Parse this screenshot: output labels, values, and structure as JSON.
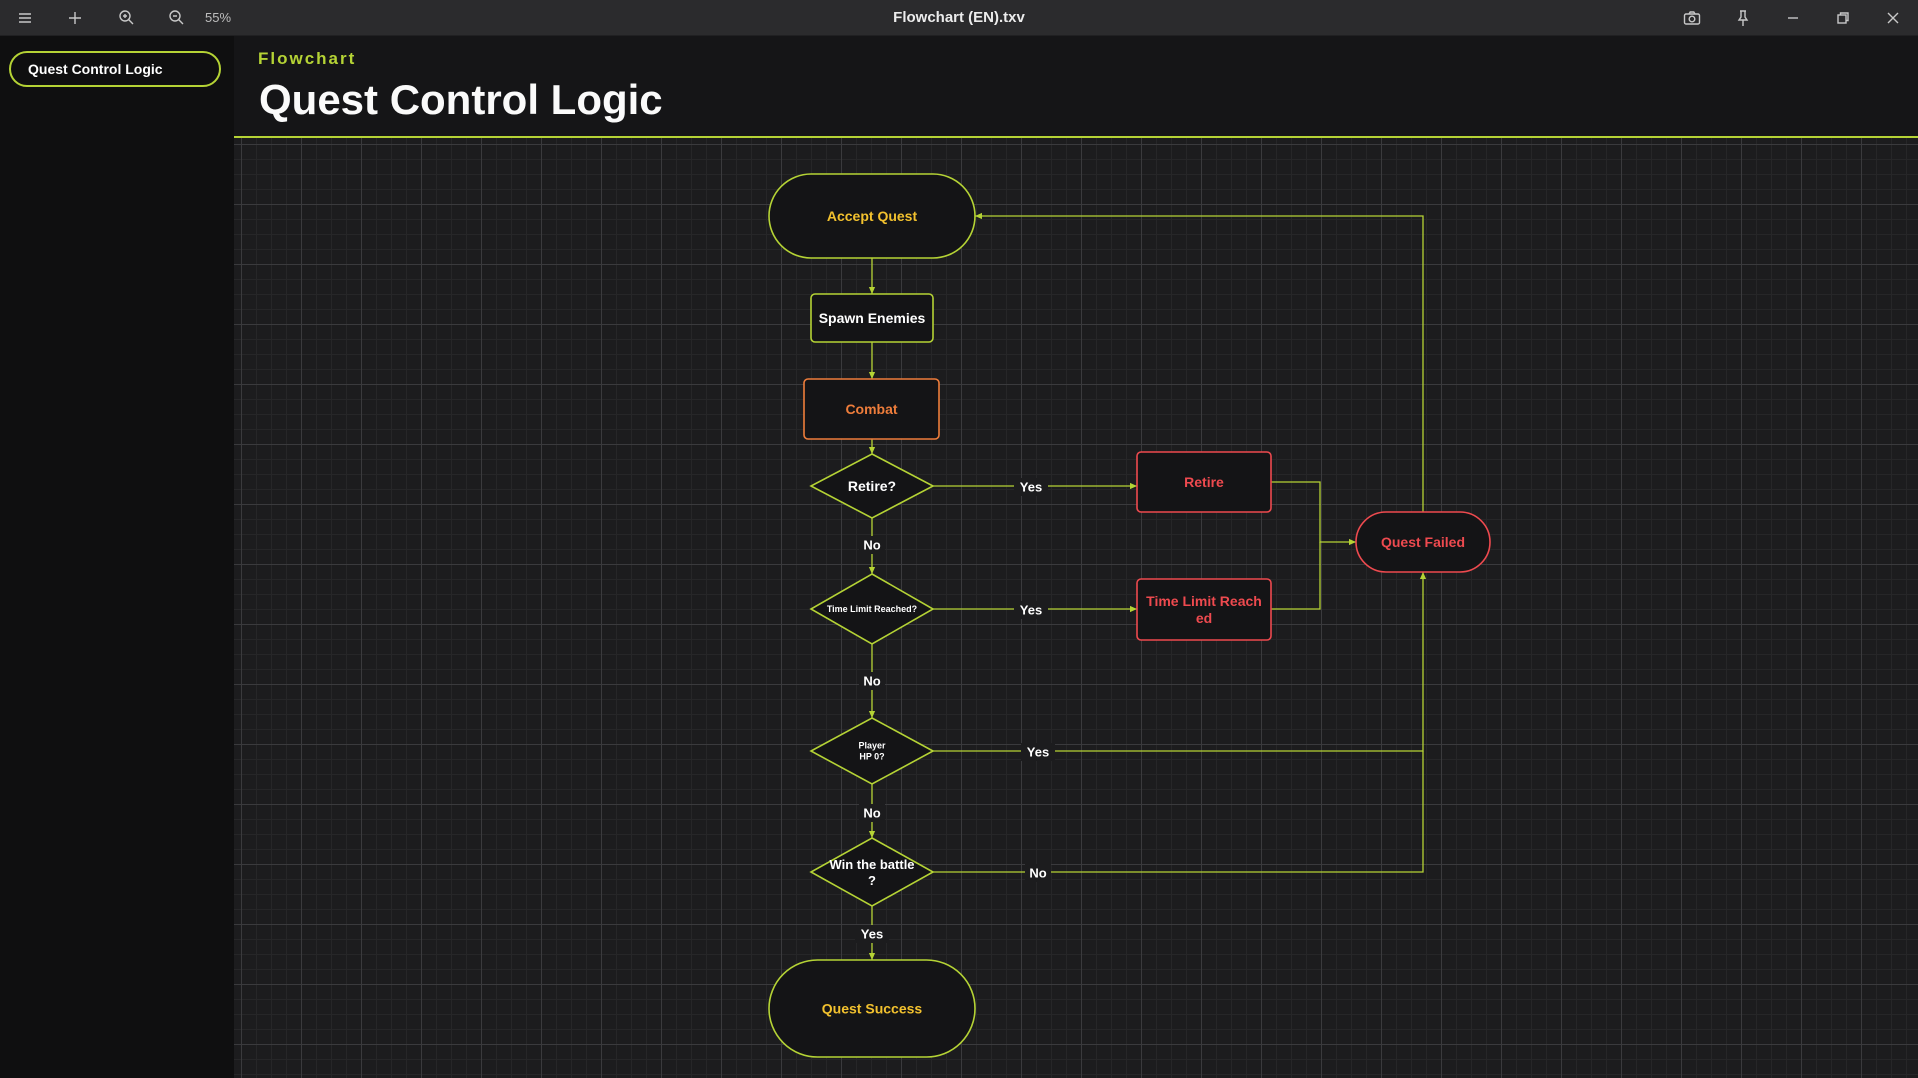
{
  "window": {
    "title": "Flowchart (EN).txv",
    "zoom": "55%"
  },
  "toolbar_icons": [
    "menu-icon",
    "plus-icon",
    "zoom-in-icon",
    "zoom-out-icon"
  ],
  "window_icons": [
    "camera-icon",
    "pin-icon",
    "minimize-icon",
    "restore-icon",
    "close-icon"
  ],
  "sidebar": {
    "items": [
      {
        "label": "Quest Control Logic",
        "selected": true
      }
    ]
  },
  "header": {
    "kind": "Flowchart",
    "title": "Quest Control Logic"
  },
  "colors": {
    "accent": "#b5d335",
    "terminal_text": "#f2c12e",
    "process_text": "#ffffff",
    "combat": "#ee7d3b",
    "failure": "#ee4a4f",
    "node_fill": "#141416"
  },
  "flowchart": {
    "nodes": {
      "accept_quest": {
        "label": "Accept Quest",
        "shape": "terminal",
        "style": "start"
      },
      "spawn_enemies": {
        "label": "Spawn Enemies",
        "shape": "process",
        "style": "normal"
      },
      "combat": {
        "label": "Combat",
        "shape": "process",
        "style": "combat"
      },
      "retire_q": {
        "label": "Retire?",
        "shape": "decision",
        "style": "normal"
      },
      "time_q": {
        "label": "Time Limit Reached?",
        "shape": "decision",
        "style": "normal"
      },
      "hp_q": {
        "label": "Player\nHP 0?",
        "shape": "decision",
        "style": "normal"
      },
      "win_q": {
        "label": "Win the battle\n?",
        "shape": "decision",
        "style": "normal"
      },
      "retire": {
        "label": "Retire",
        "shape": "process",
        "style": "failure"
      },
      "time_limit": {
        "label": "Time Limit Reach\ned",
        "shape": "process",
        "style": "failure"
      },
      "quest_failed": {
        "label": "Quest Failed",
        "shape": "terminal",
        "style": "failure"
      },
      "quest_success": {
        "label": "Quest Success",
        "shape": "terminal",
        "style": "start"
      }
    },
    "edges": [
      {
        "from": "accept_quest",
        "to": "spawn_enemies",
        "label": ""
      },
      {
        "from": "spawn_enemies",
        "to": "combat",
        "label": ""
      },
      {
        "from": "combat",
        "to": "retire_q",
        "label": ""
      },
      {
        "from": "retire_q",
        "to": "retire",
        "label": "Yes"
      },
      {
        "from": "retire_q",
        "to": "time_q",
        "label": "No"
      },
      {
        "from": "time_q",
        "to": "time_limit",
        "label": "Yes"
      },
      {
        "from": "time_q",
        "to": "hp_q",
        "label": "No"
      },
      {
        "from": "hp_q",
        "to": "quest_failed",
        "label": "Yes"
      },
      {
        "from": "hp_q",
        "to": "win_q",
        "label": "No"
      },
      {
        "from": "win_q",
        "to": "quest_failed",
        "label": "No"
      },
      {
        "from": "win_q",
        "to": "quest_success",
        "label": "Yes"
      },
      {
        "from": "retire",
        "to": "quest_failed",
        "label": ""
      },
      {
        "from": "time_limit",
        "to": "quest_failed",
        "label": ""
      },
      {
        "from": "quest_failed",
        "to": "accept_quest",
        "label": ""
      }
    ]
  }
}
